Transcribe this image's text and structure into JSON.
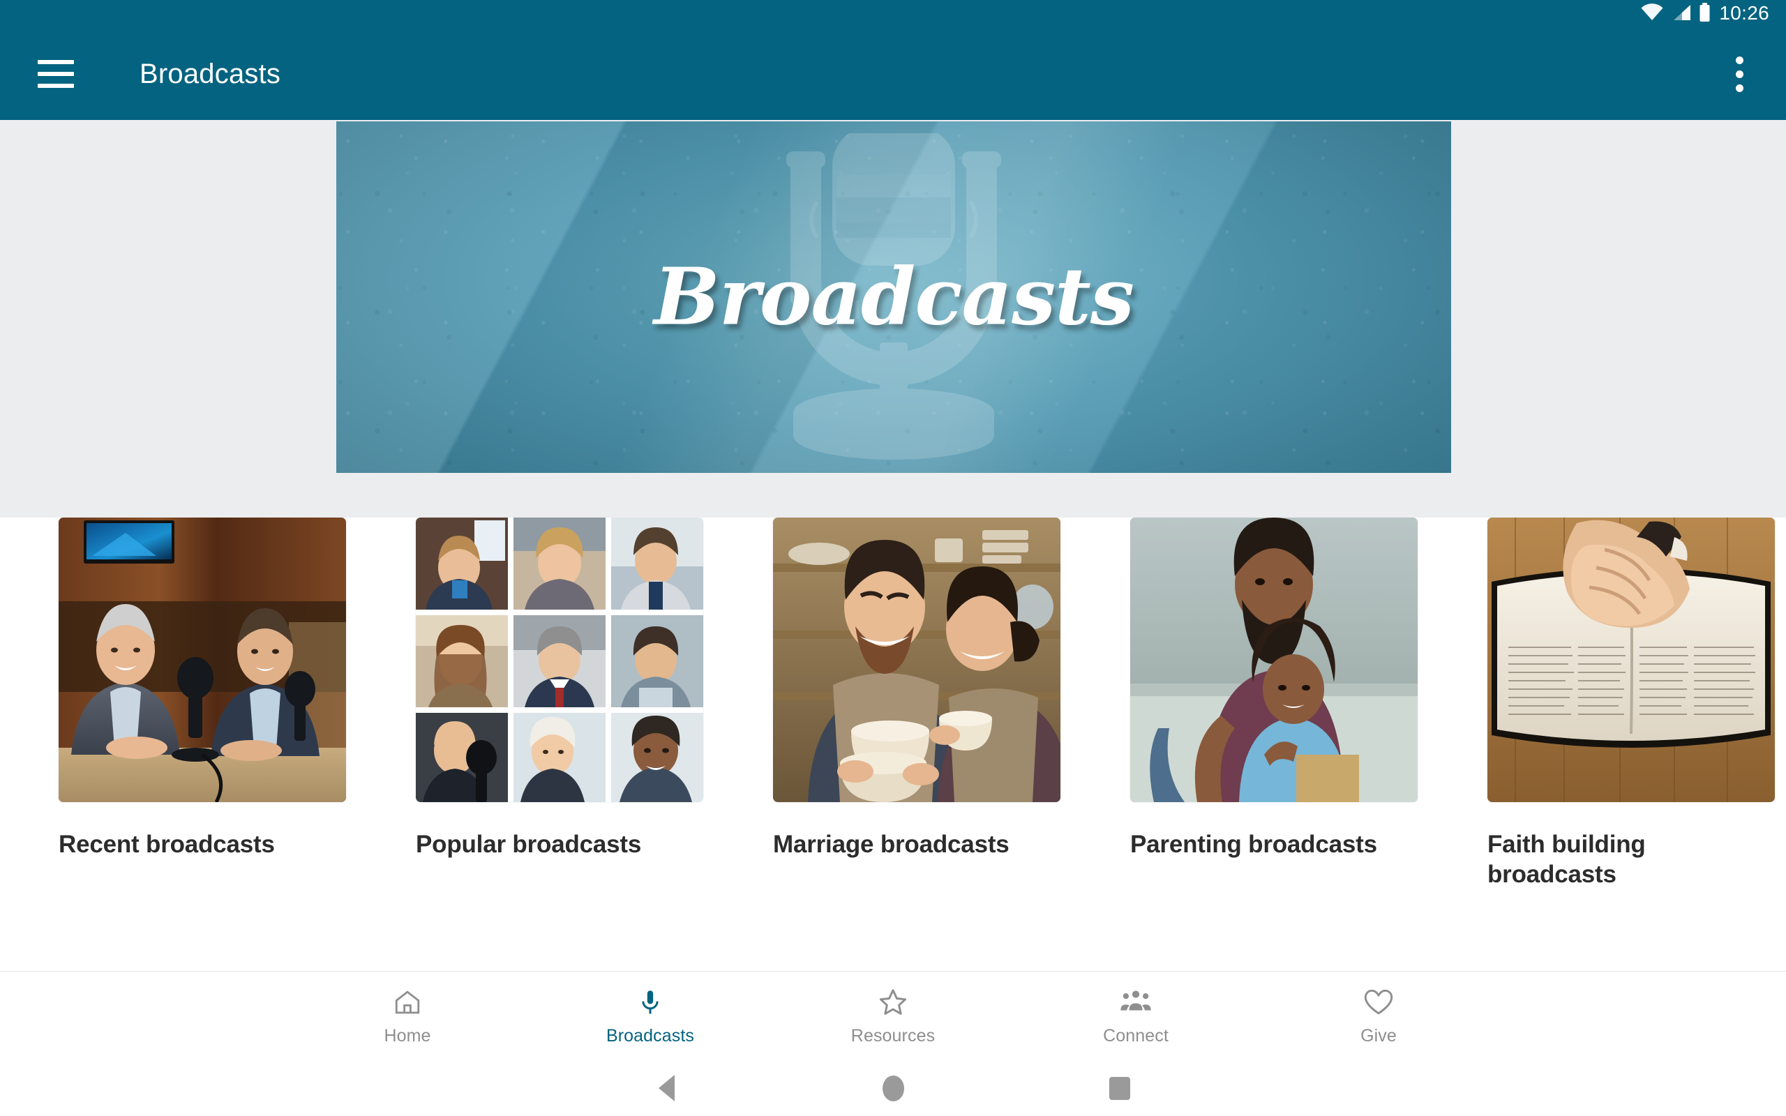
{
  "status_bar": {
    "time": "10:26",
    "icons": [
      "wifi-icon",
      "cellular-signal-icon",
      "battery-icon"
    ]
  },
  "app_bar": {
    "menu_icon": "hamburger-menu-icon",
    "title": "Broadcasts",
    "overflow_icon": "overflow-menu-icon"
  },
  "hero": {
    "title": "Broadcasts",
    "watermark_icon": "vintage-microphone-icon",
    "background_color": "#4f97b0"
  },
  "cards": [
    {
      "label": "Recent broadcasts",
      "image": "two-men-podcast-studio-photo"
    },
    {
      "label": "Popular broadcasts",
      "image": "nine-portrait-collage-photo"
    },
    {
      "label": "Marriage broadcasts",
      "image": "couple-pottery-studio-photo"
    },
    {
      "label": "Parenting broadcasts",
      "image": "father-and-daughter-photo"
    },
    {
      "label": "Faith building broadcasts",
      "image": "praying-hands-on-bible-photo"
    }
  ],
  "bottom_nav": {
    "active_color": "#046380",
    "inactive_color": "#8e8e8e",
    "items": [
      {
        "label": "Home",
        "icon": "home-icon",
        "active": false
      },
      {
        "label": "Broadcasts",
        "icon": "microphone-icon",
        "active": true
      },
      {
        "label": "Resources",
        "icon": "star-icon",
        "active": false
      },
      {
        "label": "Connect",
        "icon": "people-icon",
        "active": false
      },
      {
        "label": "Give",
        "icon": "heart-icon",
        "active": false
      }
    ]
  },
  "system_nav": {
    "back": "back-triangle-icon",
    "home": "home-circle-icon",
    "recents": "recents-square-icon"
  },
  "theme": {
    "primary": "#046380",
    "surface": "#ffffff",
    "hero_backdrop": "#ecedef",
    "text_primary": "#2c2c2c"
  }
}
